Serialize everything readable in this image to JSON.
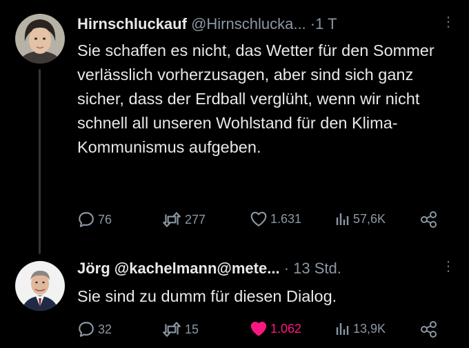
{
  "tweets": [
    {
      "name": "Hirnschluckauf",
      "handle": "@Hirnschlucka...",
      "separator": "·",
      "time": "1 T",
      "text": "Sie schaffen es nicht, das Wetter für den Sommer verlässlich vorherzusagen, aber sind sich ganz sicher, dass der Erdball verglüht, wenn wir nicht schnell all unseren Wohlstand für den Klima-Kommunismus aufgeben.",
      "replies": "76",
      "retweets": "277",
      "likes": "1.631",
      "views": "57,6K"
    },
    {
      "name": "Jörg @kachelmann@mete...",
      "separator": "·",
      "time": "13 Std.",
      "text": "Sie sind zu dumm für diesen Dialog.",
      "replies": "32",
      "retweets": "15",
      "likes": "1.062",
      "views": "13,9K"
    }
  ],
  "colors": {
    "background": "#000000",
    "text": "#e7e9ea",
    "muted": "#8b98a5",
    "like_active": "#f91880"
  }
}
